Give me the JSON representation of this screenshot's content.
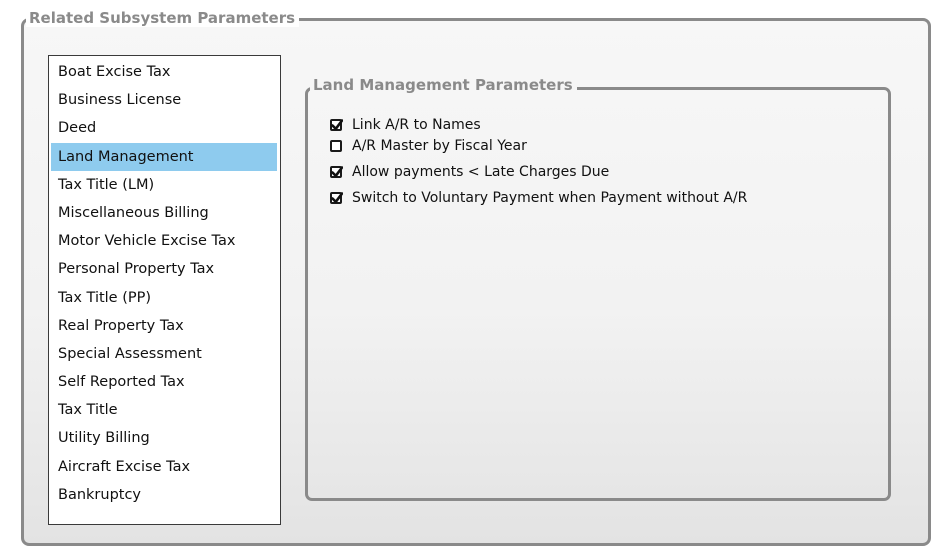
{
  "outer_group": {
    "title": "Related Subsystem Parameters"
  },
  "subsystem_list": {
    "selected_index": 3,
    "items": [
      {
        "label": "Boat Excise Tax"
      },
      {
        "label": "Business License"
      },
      {
        "label": "Deed"
      },
      {
        "label": "Land Management"
      },
      {
        "label": "Tax Title (LM)"
      },
      {
        "label": "Miscellaneous  Billing"
      },
      {
        "label": "Motor Vehicle Excise Tax"
      },
      {
        "label": "Personal Property Tax"
      },
      {
        "label": "Tax Title (PP)"
      },
      {
        "label": "Real Property Tax"
      },
      {
        "label": "Special Assessment"
      },
      {
        "label": "Self Reported Tax"
      },
      {
        "label": "Tax Title"
      },
      {
        "label": "Utility Billing"
      },
      {
        "label": "Aircraft Excise Tax"
      },
      {
        "label": "Bankruptcy"
      }
    ]
  },
  "inner_group": {
    "title": "Land Management Parameters"
  },
  "options": [
    {
      "label": "Link A/R to Names",
      "checked": true
    },
    {
      "label": "A/R Master by Fiscal Year",
      "checked": false
    },
    {
      "label": "Allow payments < Late Charges Due",
      "checked": true
    },
    {
      "label": "Switch to Voluntary Payment when Payment without A/R",
      "checked": true
    }
  ],
  "colors": {
    "selection": "#8ecbee",
    "group_border": "#8a8a8a",
    "group_title": "#8a8a8a"
  }
}
